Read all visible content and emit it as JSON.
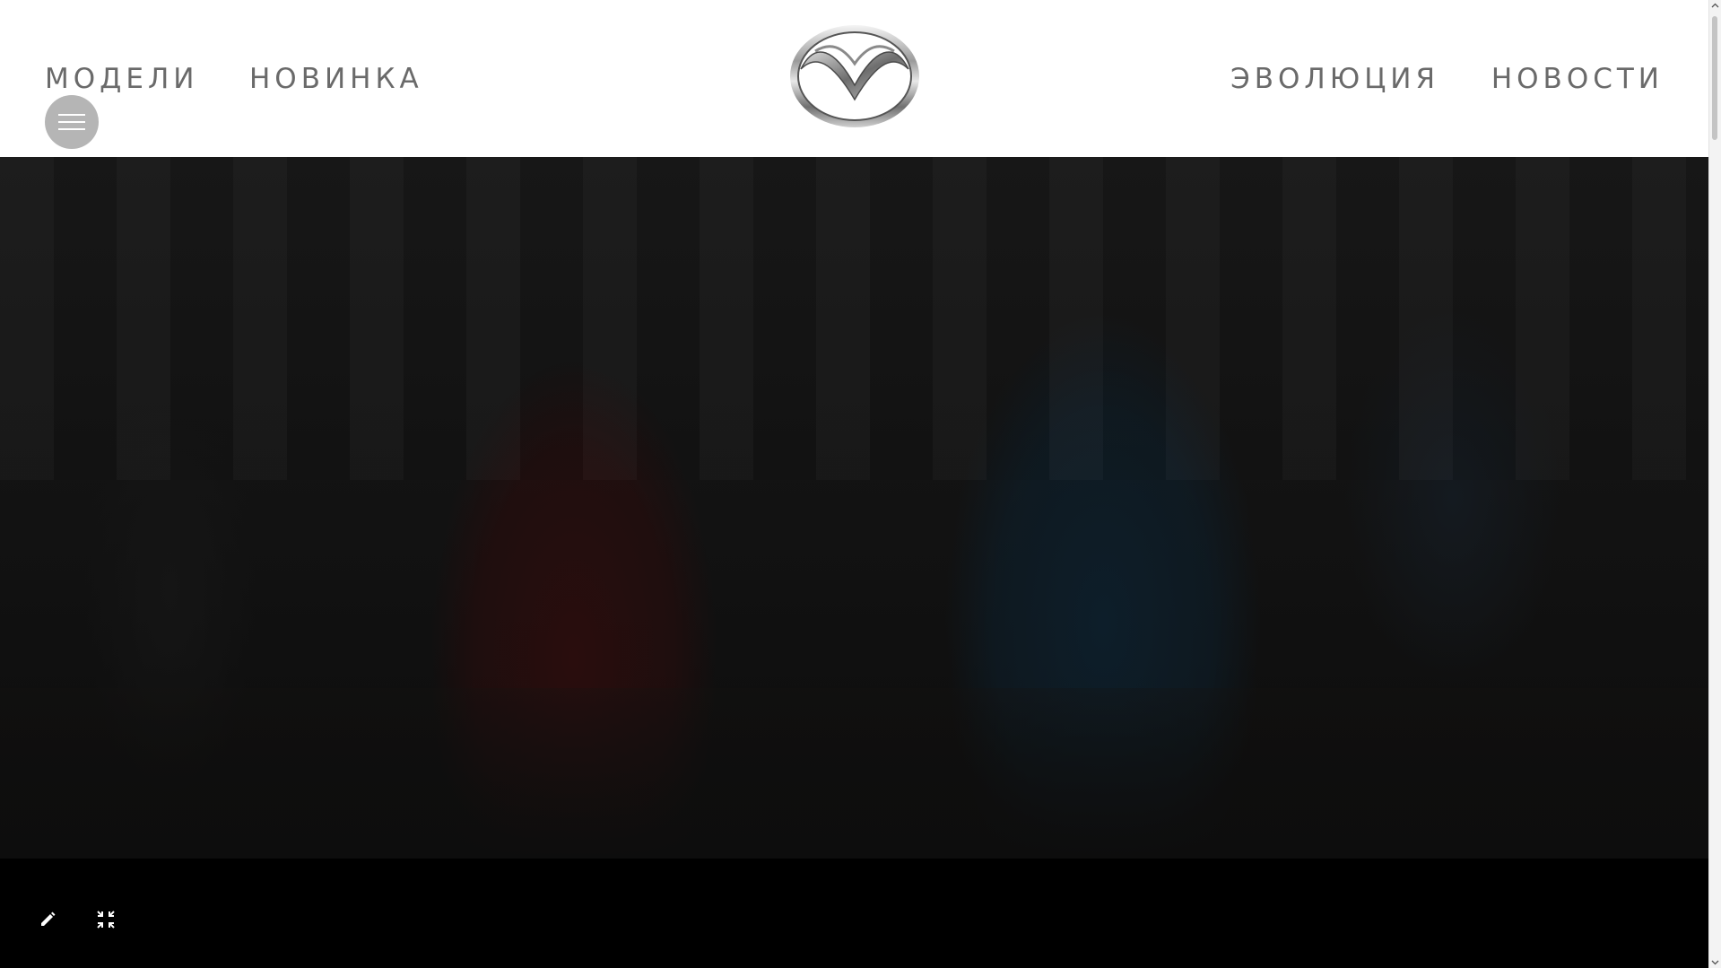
{
  "nav": {
    "left": [
      {
        "label": "МОДЕЛИ"
      },
      {
        "label": "НОВИНКА"
      }
    ],
    "right": [
      {
        "label": "ЭВОЛЮЦИЯ"
      },
      {
        "label": "НОВОСТИ"
      }
    ]
  },
  "icons": {
    "menu": "hamburger-menu-icon",
    "logo": "mazda-logo",
    "edit": "pencil-icon",
    "collapse": "exit-fullscreen-icon",
    "scroll_up": "chevron-up-icon",
    "scroll_down": "chevron-down-icon"
  },
  "colors": {
    "header_bg": "#ffffff",
    "nav_text": "#6a6a6a",
    "menu_button": "#b5b5b5",
    "hero_overlay": "#141414",
    "bottom_bar": "#000000"
  }
}
